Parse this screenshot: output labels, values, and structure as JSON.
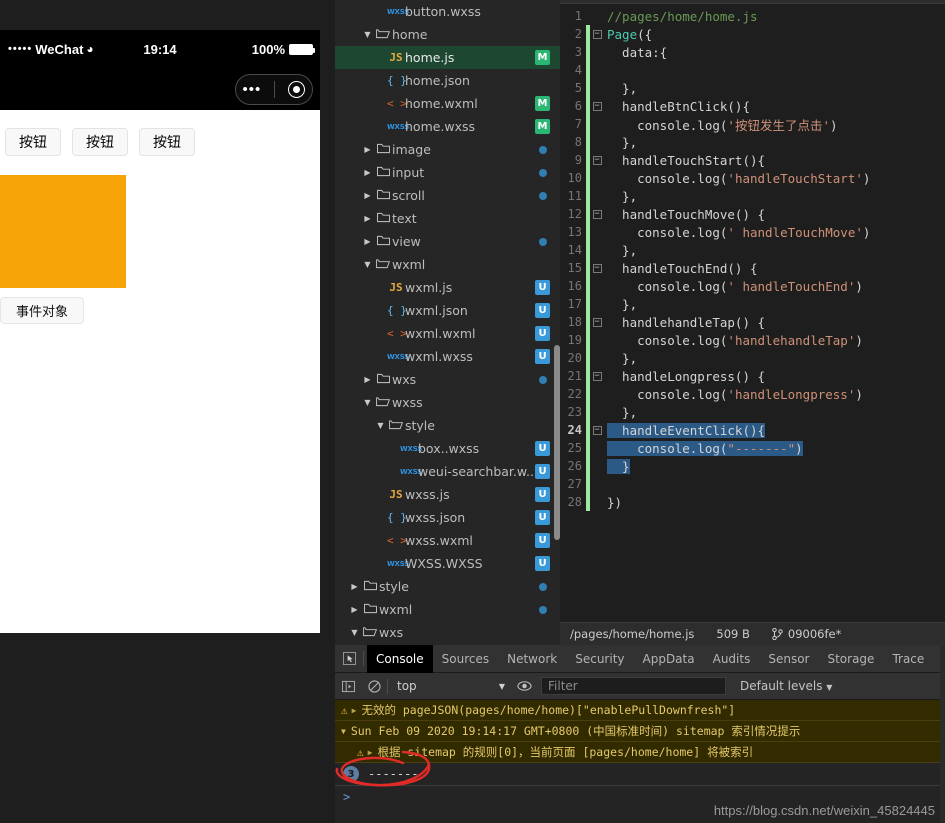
{
  "simulator": {
    "status_bar": {
      "dots": "•••••",
      "carrier": "WeChat",
      "wifi_icon": "wifi-icon",
      "time": "19:14",
      "battery_percent": "100%"
    },
    "capsule": {
      "menu_icon": "ellipsis-icon",
      "close_icon": "target-circle-icon"
    },
    "buttons": [
      "按钮",
      "按钮",
      "按钮"
    ],
    "orange_box_color": "#f5a306",
    "event_button": "事件对象"
  },
  "filetree": {
    "items": [
      {
        "label": "button.wxss",
        "icon": "wxss-file-icon",
        "indent": 3,
        "twisty": "",
        "badge": "",
        "dot": false,
        "selected": false
      },
      {
        "label": "home",
        "icon": "folder-open-icon",
        "indent": 2,
        "twisty": "▼",
        "badge": "",
        "dot": false,
        "selected": false
      },
      {
        "label": "home.js",
        "icon": "js-file-icon",
        "indent": 3,
        "twisty": "",
        "badge": "M",
        "dot": false,
        "selected": true
      },
      {
        "label": "home.json",
        "icon": "json-file-icon",
        "indent": 3,
        "twisty": "",
        "badge": "",
        "dot": false,
        "selected": false
      },
      {
        "label": "home.wxml",
        "icon": "wxml-file-icon",
        "indent": 3,
        "twisty": "",
        "badge": "M",
        "dot": false,
        "selected": false
      },
      {
        "label": "home.wxss",
        "icon": "wxss-file-icon",
        "indent": 3,
        "twisty": "",
        "badge": "M",
        "dot": false,
        "selected": false
      },
      {
        "label": "image",
        "icon": "folder-icon",
        "indent": 2,
        "twisty": "▶",
        "badge": "",
        "dot": true,
        "selected": false
      },
      {
        "label": "input",
        "icon": "folder-icon",
        "indent": 2,
        "twisty": "▶",
        "badge": "",
        "dot": true,
        "selected": false
      },
      {
        "label": "scroll",
        "icon": "folder-icon",
        "indent": 2,
        "twisty": "▶",
        "badge": "",
        "dot": true,
        "selected": false
      },
      {
        "label": "text",
        "icon": "folder-icon",
        "indent": 2,
        "twisty": "▶",
        "badge": "",
        "dot": false,
        "selected": false
      },
      {
        "label": "view",
        "icon": "folder-icon",
        "indent": 2,
        "twisty": "▶",
        "badge": "",
        "dot": true,
        "selected": false
      },
      {
        "label": "wxml",
        "icon": "folder-open-icon",
        "indent": 2,
        "twisty": "▼",
        "badge": "",
        "dot": false,
        "selected": false
      },
      {
        "label": "wxml.js",
        "icon": "js-file-icon",
        "indent": 3,
        "twisty": "",
        "badge": "U",
        "dot": false,
        "selected": false
      },
      {
        "label": "wxml.json",
        "icon": "json-file-icon",
        "indent": 3,
        "twisty": "",
        "badge": "U",
        "dot": false,
        "selected": false
      },
      {
        "label": "wxml.wxml",
        "icon": "wxml-file-icon",
        "indent": 3,
        "twisty": "",
        "badge": "U",
        "dot": false,
        "selected": false
      },
      {
        "label": "wxml.wxss",
        "icon": "wxss-file-icon",
        "indent": 3,
        "twisty": "",
        "badge": "U",
        "dot": false,
        "selected": false
      },
      {
        "label": "wxs",
        "icon": "folder-icon",
        "indent": 2,
        "twisty": "▶",
        "badge": "",
        "dot": true,
        "selected": false
      },
      {
        "label": "wxss",
        "icon": "folder-open-icon",
        "indent": 2,
        "twisty": "▼",
        "badge": "",
        "dot": false,
        "selected": false
      },
      {
        "label": "style",
        "icon": "folder-open-icon",
        "indent": 3,
        "twisty": "▼",
        "badge": "",
        "dot": false,
        "selected": false
      },
      {
        "label": "box..wxss",
        "icon": "wxss-file-icon",
        "indent": 4,
        "twisty": "",
        "badge": "U",
        "dot": false,
        "selected": false
      },
      {
        "label": "weui-searchbar.w...",
        "icon": "wxss-file-icon",
        "indent": 4,
        "twisty": "",
        "badge": "U",
        "dot": false,
        "selected": false
      },
      {
        "label": "wxss.js",
        "icon": "js-file-icon",
        "indent": 3,
        "twisty": "",
        "badge": "U",
        "dot": false,
        "selected": false
      },
      {
        "label": "wxss.json",
        "icon": "json-file-icon",
        "indent": 3,
        "twisty": "",
        "badge": "U",
        "dot": false,
        "selected": false
      },
      {
        "label": "wxss.wxml",
        "icon": "wxml-file-icon",
        "indent": 3,
        "twisty": "",
        "badge": "U",
        "dot": false,
        "selected": false
      },
      {
        "label": "WXSS.WXSS",
        "icon": "wxss-file-icon",
        "indent": 3,
        "twisty": "",
        "badge": "U",
        "dot": false,
        "selected": false
      },
      {
        "label": "style",
        "icon": "folder-icon",
        "indent": 1,
        "twisty": "▶",
        "badge": "",
        "dot": true,
        "selected": false
      },
      {
        "label": "wxml",
        "icon": "folder-icon",
        "indent": 1,
        "twisty": "▶",
        "badge": "",
        "dot": true,
        "selected": false
      },
      {
        "label": "wxs",
        "icon": "folder-open-icon",
        "indent": 1,
        "twisty": "▼",
        "badge": "",
        "dot": false,
        "selected": false
      }
    ]
  },
  "editor": {
    "lines": [
      {
        "n": 1,
        "mod": false,
        "fold": false,
        "tokens": [
          {
            "t": "//pages/home/home.js",
            "c": "c-comment"
          }
        ]
      },
      {
        "n": 2,
        "mod": true,
        "fold": true,
        "tokens": [
          {
            "t": "Page",
            "c": "c-fn"
          },
          {
            "t": "({",
            "c": "c-plain"
          }
        ]
      },
      {
        "n": 3,
        "mod": true,
        "fold": false,
        "tokens": [
          {
            "t": "  data:{",
            "c": "c-plain"
          }
        ]
      },
      {
        "n": 4,
        "mod": true,
        "fold": false,
        "tokens": []
      },
      {
        "n": 5,
        "mod": true,
        "fold": false,
        "tokens": [
          {
            "t": "  },",
            "c": "c-plain"
          }
        ]
      },
      {
        "n": 6,
        "mod": true,
        "fold": true,
        "tokens": [
          {
            "t": "  handleBtnClick(){",
            "c": "c-plain"
          }
        ]
      },
      {
        "n": 7,
        "mod": true,
        "fold": false,
        "tokens": [
          {
            "t": "    console.log(",
            "c": "c-plain"
          },
          {
            "t": "'按钮发生了点击'",
            "c": "c-str"
          },
          {
            "t": ")",
            "c": "c-plain"
          }
        ]
      },
      {
        "n": 8,
        "mod": true,
        "fold": false,
        "tokens": [
          {
            "t": "  },",
            "c": "c-plain"
          }
        ]
      },
      {
        "n": 9,
        "mod": true,
        "fold": true,
        "tokens": [
          {
            "t": "  handleTouchStart(){",
            "c": "c-plain"
          }
        ]
      },
      {
        "n": 10,
        "mod": true,
        "fold": false,
        "tokens": [
          {
            "t": "    console.log(",
            "c": "c-plain"
          },
          {
            "t": "'handleTouchStart'",
            "c": "c-str"
          },
          {
            "t": ")",
            "c": "c-plain"
          }
        ]
      },
      {
        "n": 11,
        "mod": true,
        "fold": false,
        "tokens": [
          {
            "t": "  },",
            "c": "c-plain"
          }
        ]
      },
      {
        "n": 12,
        "mod": true,
        "fold": true,
        "tokens": [
          {
            "t": "  handleTouchMove() {",
            "c": "c-plain"
          }
        ]
      },
      {
        "n": 13,
        "mod": true,
        "fold": false,
        "tokens": [
          {
            "t": "    console.log(",
            "c": "c-plain"
          },
          {
            "t": "' handleTouchMove'",
            "c": "c-str"
          },
          {
            "t": ")",
            "c": "c-plain"
          }
        ]
      },
      {
        "n": 14,
        "mod": true,
        "fold": false,
        "tokens": [
          {
            "t": "  },",
            "c": "c-plain"
          }
        ]
      },
      {
        "n": 15,
        "mod": true,
        "fold": true,
        "tokens": [
          {
            "t": "  handleTouchEnd() {",
            "c": "c-plain"
          }
        ]
      },
      {
        "n": 16,
        "mod": true,
        "fold": false,
        "tokens": [
          {
            "t": "    console.log(",
            "c": "c-plain"
          },
          {
            "t": "' handleTouchEnd'",
            "c": "c-str"
          },
          {
            "t": ")",
            "c": "c-plain"
          }
        ]
      },
      {
        "n": 17,
        "mod": true,
        "fold": false,
        "tokens": [
          {
            "t": "  },",
            "c": "c-plain"
          }
        ]
      },
      {
        "n": 18,
        "mod": true,
        "fold": true,
        "tokens": [
          {
            "t": "  handlehandleTap() {",
            "c": "c-plain"
          }
        ]
      },
      {
        "n": 19,
        "mod": true,
        "fold": false,
        "tokens": [
          {
            "t": "    console.log(",
            "c": "c-plain"
          },
          {
            "t": "'handlehandleTap'",
            "c": "c-str"
          },
          {
            "t": ")",
            "c": "c-plain"
          }
        ]
      },
      {
        "n": 20,
        "mod": true,
        "fold": false,
        "tokens": [
          {
            "t": "  },",
            "c": "c-plain"
          }
        ]
      },
      {
        "n": 21,
        "mod": true,
        "fold": true,
        "tokens": [
          {
            "t": "  handleLongpress() {",
            "c": "c-plain"
          }
        ]
      },
      {
        "n": 22,
        "mod": true,
        "fold": false,
        "tokens": [
          {
            "t": "    console.log(",
            "c": "c-plain"
          },
          {
            "t": "'handleLongpress'",
            "c": "c-str"
          },
          {
            "t": ")",
            "c": "c-plain"
          }
        ]
      },
      {
        "n": 23,
        "mod": true,
        "fold": false,
        "tokens": [
          {
            "t": "  },",
            "c": "c-plain"
          }
        ]
      },
      {
        "n": 24,
        "mod": true,
        "fold": true,
        "current": true,
        "selected": true,
        "tokens": [
          {
            "t": "  handleEventClick(){",
            "c": "c-plain"
          }
        ]
      },
      {
        "n": 25,
        "mod": true,
        "fold": false,
        "selected": true,
        "tokens": [
          {
            "t": "    console.log(",
            "c": "c-plain"
          },
          {
            "t": "\"-------\"",
            "c": "c-str"
          },
          {
            "t": ")",
            "c": "c-plain"
          }
        ]
      },
      {
        "n": 26,
        "mod": true,
        "fold": false,
        "selected": true,
        "tokens": [
          {
            "t": "  }",
            "c": "c-plain"
          }
        ]
      },
      {
        "n": 27,
        "mod": true,
        "fold": false,
        "tokens": []
      },
      {
        "n": 28,
        "mod": true,
        "fold": false,
        "tokens": [
          {
            "t": "})",
            "c": "c-plain"
          }
        ]
      }
    ],
    "status": {
      "path": "/pages/home/home.js",
      "size": "509 B",
      "branch_icon": "git-branch-icon",
      "branch": "09006fe*"
    }
  },
  "devtools": {
    "inspect_icon": "inspect-element-icon",
    "tabs": [
      {
        "label": "Console",
        "active": true
      },
      {
        "label": "Sources",
        "active": false
      },
      {
        "label": "Network",
        "active": false
      },
      {
        "label": "Security",
        "active": false
      },
      {
        "label": "AppData",
        "active": false
      },
      {
        "label": "Audits",
        "active": false
      },
      {
        "label": "Sensor",
        "active": false
      },
      {
        "label": "Storage",
        "active": false
      },
      {
        "label": "Trace",
        "active": false
      }
    ],
    "toolbar": {
      "sidebar_icon": "console-sidebar-icon",
      "clear_icon": "clear-console-icon",
      "context": "top",
      "chevron": "▼",
      "eye_icon": "live-expression-icon",
      "filter_placeholder": "Filter",
      "levels": "Default levels",
      "levels_chevron": "▼"
    },
    "logs": [
      {
        "type": "warn",
        "icon": "warning-icon",
        "tri": "▶",
        "text": "无效的 pageJSON(pages/home/home)[\"enablePullDownfresh\"]",
        "sub": false
      },
      {
        "type": "warn",
        "icon": "",
        "tri": "▼",
        "text": "Sun Feb 09 2020 19:14:17 GMT+0800 (中国标准时间) sitemap 索引情况提示",
        "sub": false
      },
      {
        "type": "warn",
        "icon": "warning-icon",
        "tri": "▶",
        "text": "根据 sitemap 的规则[0]，当前页面 [pages/home/home] 将被索引",
        "sub": true
      }
    ],
    "output": {
      "count": "3",
      "text": "-------"
    },
    "prompt": ">",
    "annotation_color": "#e02b28"
  },
  "watermark": "https://blog.csdn.net/weixin_45824445"
}
